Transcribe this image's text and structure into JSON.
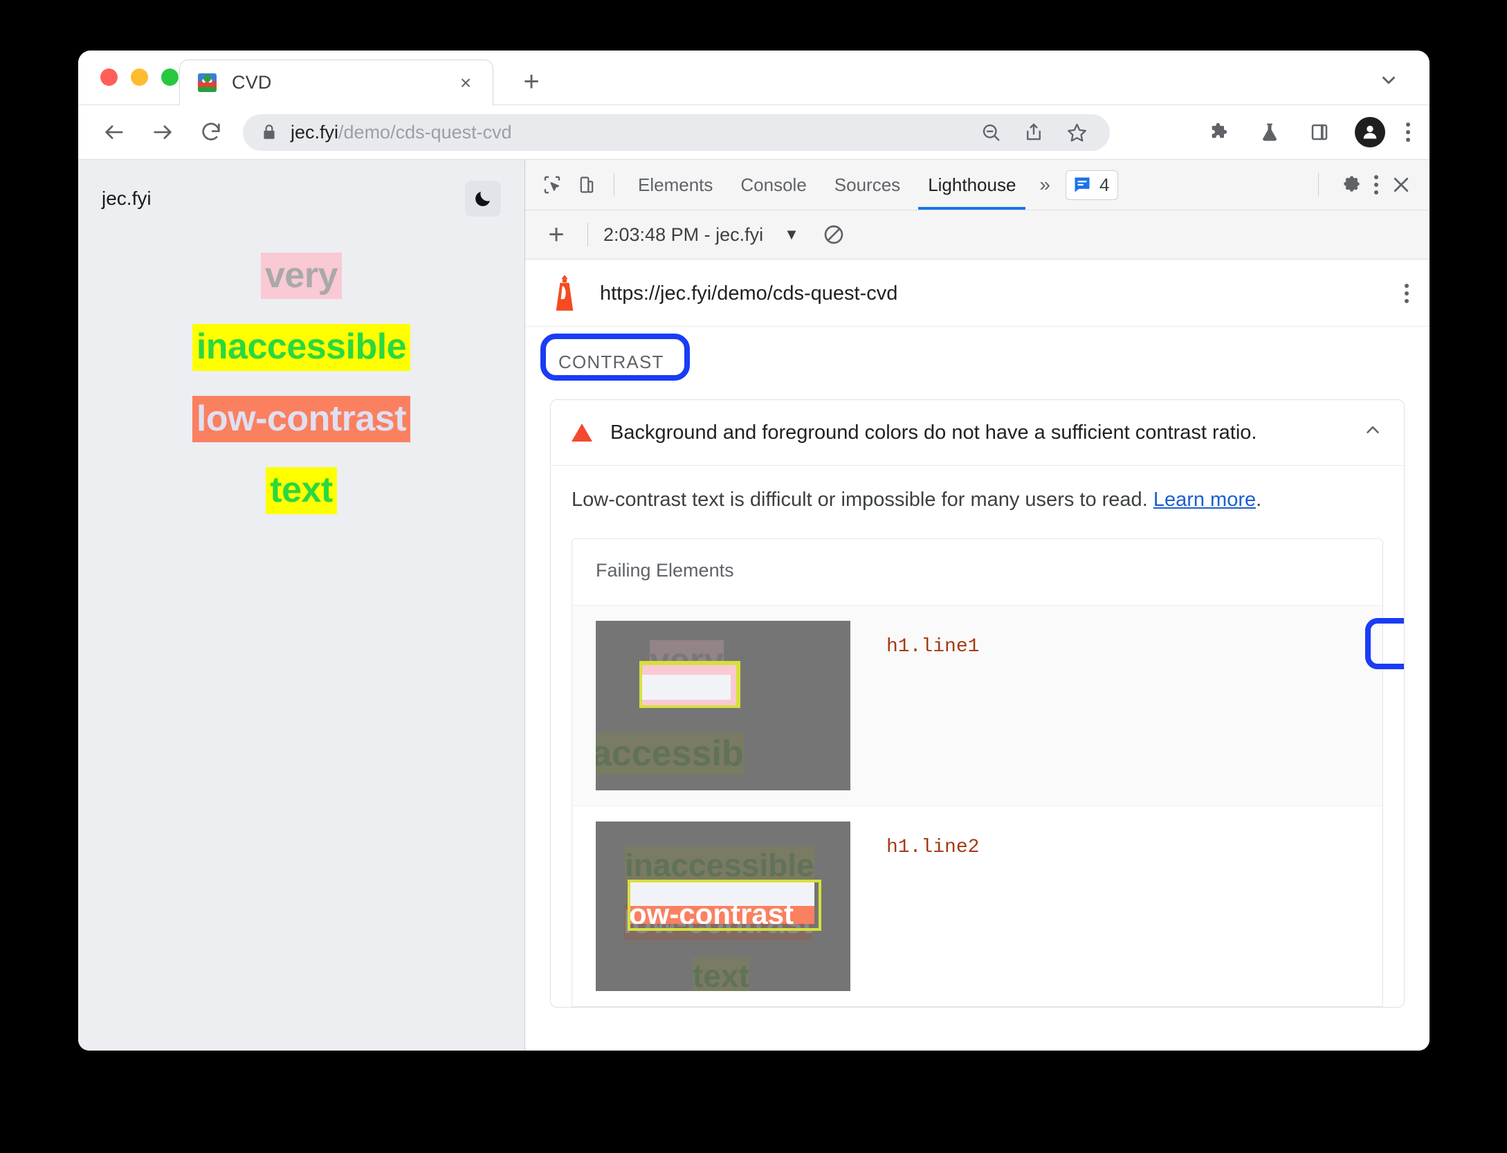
{
  "browser": {
    "tab": {
      "title": "CVD",
      "favicon": "chrome-favicon",
      "close_label": "×"
    },
    "new_tab_label": "+",
    "tabstrip_chevron": "chevron-down-icon",
    "omnibox": {
      "lock": "lock-icon",
      "url_domain": "jec.fyi",
      "url_path": "/demo/cds-quest-cvd",
      "icons": [
        "zoom-out-icon",
        "share-icon",
        "bookmark-star-icon"
      ]
    },
    "toolbar_icons": [
      "back-arrow",
      "forward-arrow",
      "reload-icon"
    ],
    "right_icons": [
      "extensions-puzzle-icon",
      "labs-flask-icon",
      "side-panel-icon",
      "profile-avatar",
      "browser-menu-kebab"
    ]
  },
  "page": {
    "brand": "jec.fyi",
    "theme_toggle": "dark-mode-moon-icon",
    "samples": [
      {
        "text": "very",
        "bg": "#f9c9d4",
        "fg": "#a9a9a9"
      },
      {
        "text": "inaccessible",
        "bg": "#ffff00",
        "fg": "#2ad83f"
      },
      {
        "text": "low-contrast",
        "bg": "#fa8060",
        "fg": "#dfe0f2"
      },
      {
        "text": "text",
        "bg": "#ffff00",
        "fg": "#2ad83f"
      }
    ]
  },
  "devtools": {
    "inspect_icon": "inspect-cursor-icon",
    "device_icon": "device-toolbar-icon",
    "tabs": [
      {
        "label": "Elements",
        "active": false
      },
      {
        "label": "Console",
        "active": false
      },
      {
        "label": "Sources",
        "active": false
      },
      {
        "label": "Lighthouse",
        "active": true
      }
    ],
    "overflow_label": "»",
    "issues": {
      "icon": "issues-message-icon",
      "count": "4",
      "color": "#1a73e8"
    },
    "settings_icon": "gear-icon",
    "more_icon": "devtools-menu-kebab",
    "close_icon": "close-icon",
    "lighthouse_toolbar": {
      "add_label": "+",
      "run_label": "2:03:48 PM - jec.fyi",
      "caret": "▼",
      "clear_icon": "clear-no-entry-icon"
    }
  },
  "report": {
    "logo": "lighthouse-logo",
    "url": "https://jec.fyi/demo/cds-quest-cvd",
    "kebab": "report-menu-kebab",
    "category_label": "CONTRAST",
    "audit": {
      "warning_icon": "warning-triangle-icon",
      "title": "Background and foreground colors do not have a sufficient contrast ratio.",
      "collapse_icon": "chevron-up-icon",
      "description_before": "Low-contrast text is difficult or impossible for many users to read. ",
      "description_link": "Learn more",
      "description_after": ".",
      "failing_elements_title": "Failing Elements",
      "rows": [
        {
          "selector": "h1.line1",
          "highlighted": true
        },
        {
          "selector": "h1.line2",
          "highlighted": false
        }
      ]
    }
  },
  "annotations": {
    "color": "#1a3cf5",
    "targets": [
      "CONTRAST",
      "h1.line1"
    ]
  }
}
